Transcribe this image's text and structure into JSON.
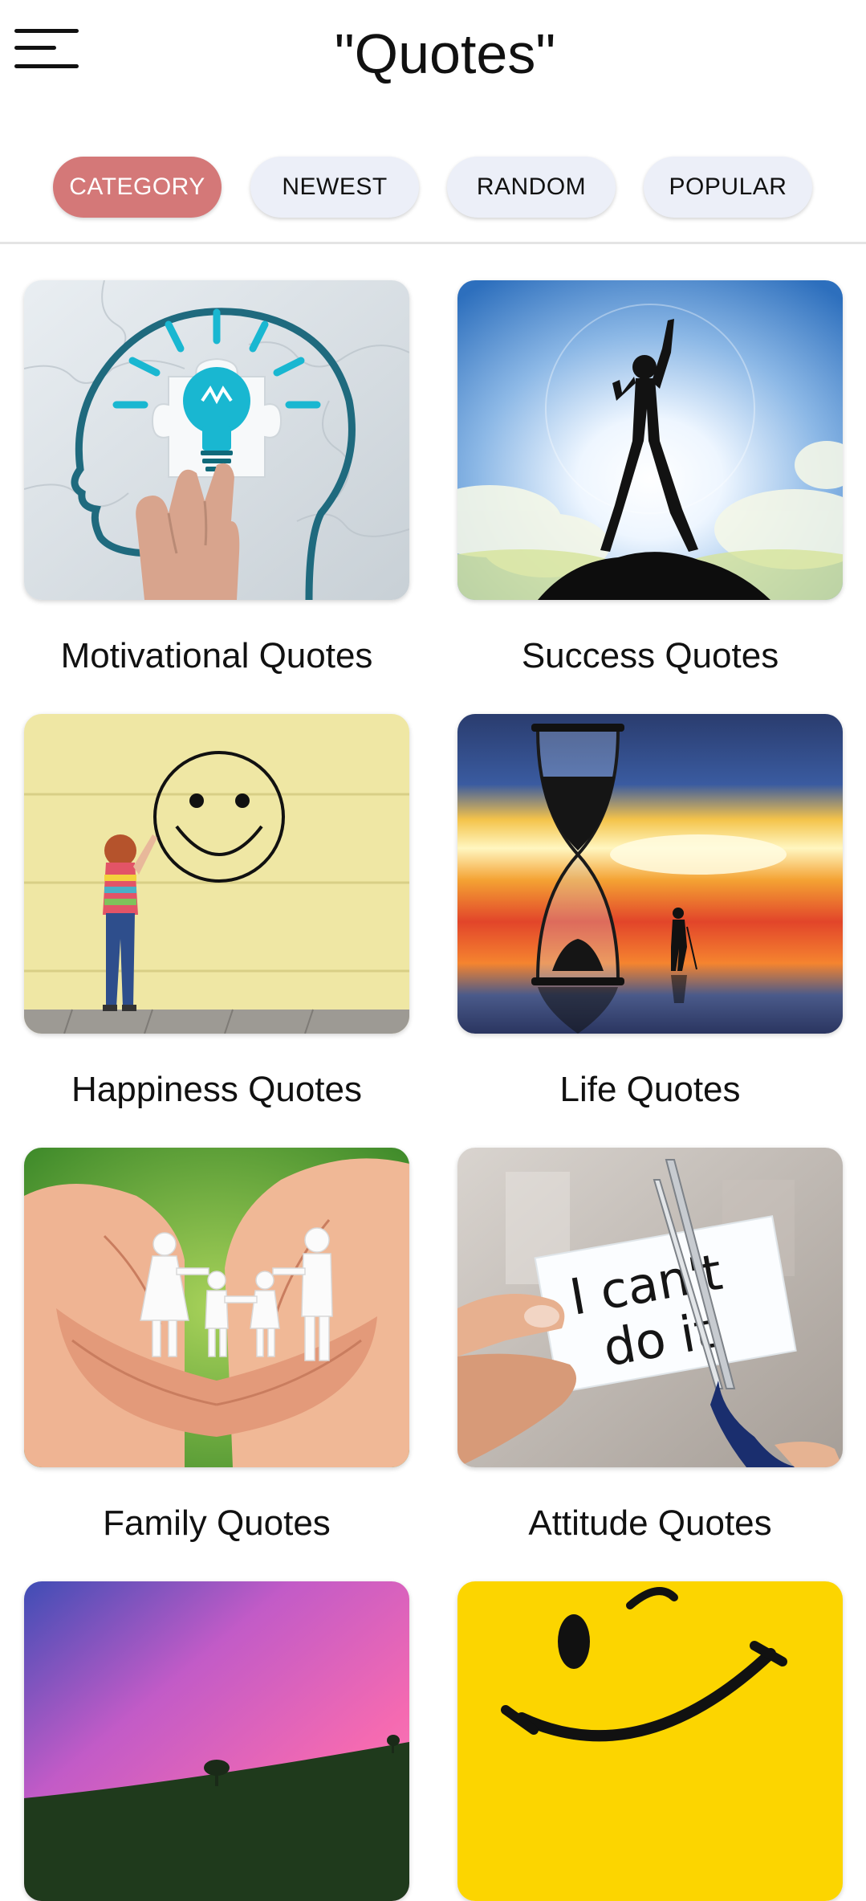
{
  "header": {
    "menu_icon": "hamburger-menu-icon",
    "title": "\"Quotes\""
  },
  "tabs": [
    {
      "label": "CATEGORY",
      "active": true
    },
    {
      "label": "NEWEST",
      "active": false
    },
    {
      "label": "RANDOM",
      "active": false
    },
    {
      "label": "POPULAR",
      "active": false
    }
  ],
  "colors": {
    "active_tab": "#d47878",
    "inactive_tab": "#eceff8",
    "divider": "#e4e4e4"
  },
  "categories": [
    {
      "label": "Motivational Quotes",
      "image": "lightbulb-head-puzzle"
    },
    {
      "label": "Success Quotes",
      "image": "silhouette-mountain-peak"
    },
    {
      "label": "Happiness Quotes",
      "image": "child-drawing-smiley"
    },
    {
      "label": "Life Quotes",
      "image": "hourglass-sunset"
    },
    {
      "label": "Family Quotes",
      "image": "paper-family-in-hands"
    },
    {
      "label": "Attitude Quotes",
      "image": "cutting-i-cant-do-it"
    },
    {
      "label": "",
      "image": "pink-sky-hill-tree"
    },
    {
      "label": "",
      "image": "yellow-winking-smiley"
    }
  ],
  "image_text": {
    "attitude_card_line1": "I can't",
    "attitude_card_line2": "do it"
  }
}
